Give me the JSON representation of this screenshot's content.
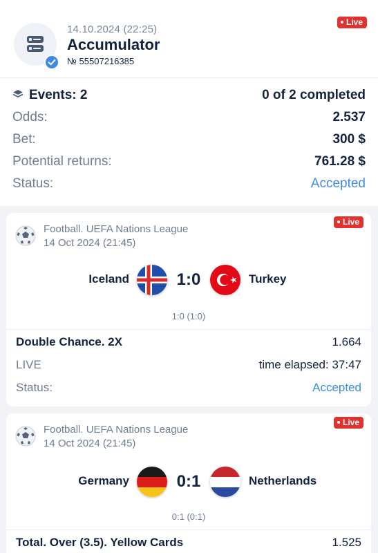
{
  "header": {
    "date": "14.10.2024 (22:25)",
    "title": "Accumulator",
    "number": "№ 55507216385",
    "live": "Live"
  },
  "summary": {
    "events_label": "Events: 2",
    "completed": "0 of 2 completed",
    "odds_label": "Odds:",
    "odds_value": "2.537",
    "bet_label": "Bet:",
    "bet_value": "300 $",
    "returns_label": "Potential returns:",
    "returns_value": "761.28 $",
    "status_label": "Status:",
    "status_value": "Accepted"
  },
  "events": [
    {
      "league": "Football. UEFA Nations League",
      "date": "14 Oct 2024 (21:45)",
      "live": "Live",
      "team1": "Iceland",
      "team2": "Turkey",
      "score": "1:0",
      "subscore": "1:0 (1:0)",
      "market": "Double Chance. 2X",
      "odds": "1.664",
      "live_label": "LIVE",
      "elapsed": "time elapsed: 37:47",
      "status_label": "Status:",
      "status_value": "Accepted"
    },
    {
      "league": "Football. UEFA Nations League",
      "date": "14 Oct 2024 (21:45)",
      "live": "Live",
      "team1": "Germany",
      "team2": "Netherlands",
      "score": "0:1",
      "subscore": "0:1 (0:1)",
      "market": "Total. Over (3.5). Yellow Cards",
      "odds": "1.525"
    }
  ],
  "icons": {
    "avatar": "accumulator-doc-icon",
    "verified": "check-icon",
    "events": "layers-icon",
    "sport": "football-icon"
  },
  "colors": {
    "accent": "#3d8be0",
    "live": "#e0322f",
    "text": "#13233f",
    "muted": "#6f7d91"
  }
}
